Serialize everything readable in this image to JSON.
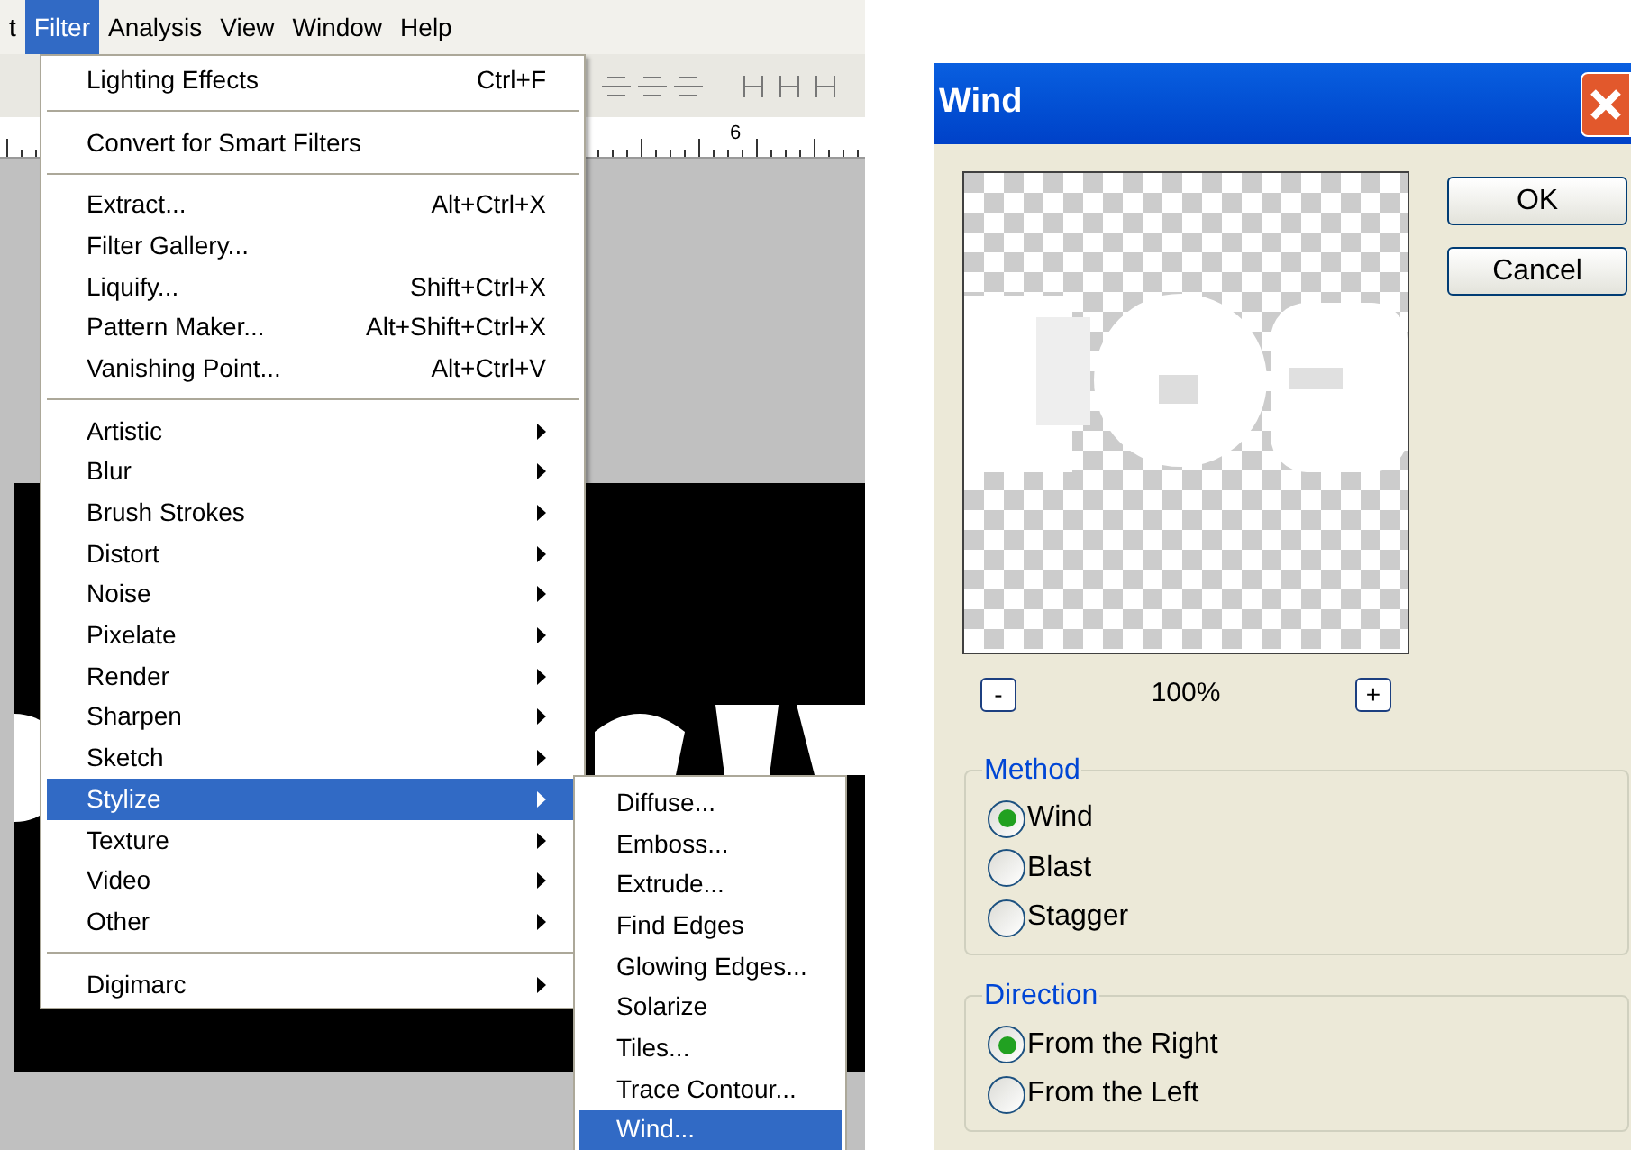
{
  "menubar": [
    {
      "label": "t",
      "selected": false
    },
    {
      "label": "Filter",
      "selected": true
    },
    {
      "label": "Analysis",
      "selected": false
    },
    {
      "label": "View",
      "selected": false
    },
    {
      "label": "Window",
      "selected": false
    },
    {
      "label": "Help",
      "selected": false
    }
  ],
  "ruler": {
    "label": "6"
  },
  "filter_menu": {
    "sections": [
      [
        {
          "label": "Lighting Effects",
          "shortcut": "Ctrl+F",
          "has_submenu": false,
          "selected": false
        }
      ],
      [
        {
          "label": "Convert for Smart Filters",
          "has_submenu": false,
          "selected": false
        }
      ],
      [
        {
          "label": "Extract...",
          "shortcut": "Alt+Ctrl+X",
          "has_submenu": false,
          "selected": false
        },
        {
          "label": "Filter Gallery...",
          "has_submenu": false,
          "selected": false
        },
        {
          "label": "Liquify...",
          "shortcut": "Shift+Ctrl+X",
          "has_submenu": false,
          "selected": false
        },
        {
          "label": "Pattern Maker...",
          "shortcut": "Alt+Shift+Ctrl+X",
          "has_submenu": false,
          "selected": false
        },
        {
          "label": "Vanishing Point...",
          "shortcut": "Alt+Ctrl+V",
          "has_submenu": false,
          "selected": false
        }
      ],
      [
        {
          "label": "Artistic",
          "has_submenu": true,
          "selected": false
        },
        {
          "label": "Blur",
          "has_submenu": true,
          "selected": false
        },
        {
          "label": "Brush Strokes",
          "has_submenu": true,
          "selected": false
        },
        {
          "label": "Distort",
          "has_submenu": true,
          "selected": false
        },
        {
          "label": "Noise",
          "has_submenu": true,
          "selected": false
        },
        {
          "label": "Pixelate",
          "has_submenu": true,
          "selected": false
        },
        {
          "label": "Render",
          "has_submenu": true,
          "selected": false
        },
        {
          "label": "Sharpen",
          "has_submenu": true,
          "selected": false
        },
        {
          "label": "Sketch",
          "has_submenu": true,
          "selected": false
        },
        {
          "label": "Stylize",
          "has_submenu": true,
          "selected": true
        },
        {
          "label": "Texture",
          "has_submenu": true,
          "selected": false
        },
        {
          "label": "Video",
          "has_submenu": true,
          "selected": false
        },
        {
          "label": "Other",
          "has_submenu": true,
          "selected": false
        }
      ],
      [
        {
          "label": "Digimarc",
          "has_submenu": true,
          "selected": false
        }
      ]
    ]
  },
  "stylize_submenu": [
    {
      "label": "Diffuse...",
      "selected": false
    },
    {
      "label": "Emboss...",
      "selected": false
    },
    {
      "label": "Extrude...",
      "selected": false
    },
    {
      "label": "Find Edges",
      "selected": false
    },
    {
      "label": "Glowing Edges...",
      "selected": false
    },
    {
      "label": "Solarize",
      "selected": false
    },
    {
      "label": "Tiles...",
      "selected": false
    },
    {
      "label": "Trace Contour...",
      "selected": false
    },
    {
      "label": "Wind...",
      "selected": true
    }
  ],
  "dialog": {
    "title": "Wind",
    "zoom": "100%",
    "zoom_out": "-",
    "zoom_in": "+",
    "buttons": [
      "OK",
      "Cancel"
    ],
    "groups": [
      {
        "legend": "Method",
        "options": [
          {
            "label": "Wind",
            "selected": true
          },
          {
            "label": "Blast",
            "selected": false
          },
          {
            "label": "Stagger",
            "selected": false
          }
        ]
      },
      {
        "legend": "Direction",
        "options": [
          {
            "label": "From the Right",
            "selected": true
          },
          {
            "label": "From the Left",
            "selected": false
          }
        ]
      }
    ]
  }
}
